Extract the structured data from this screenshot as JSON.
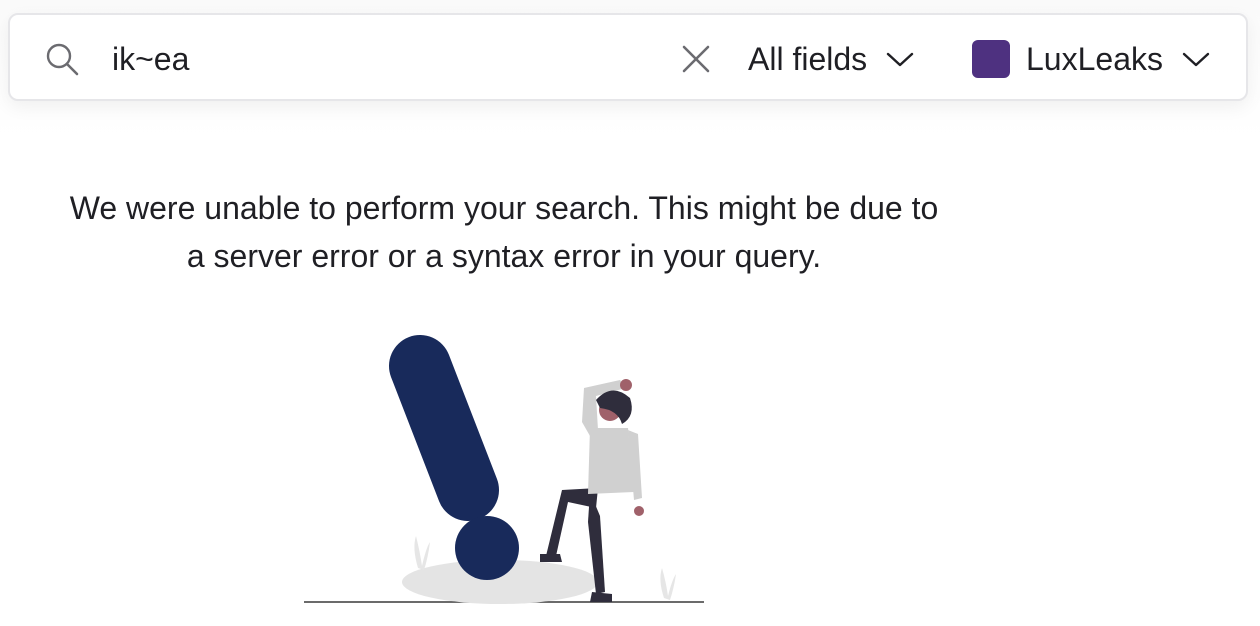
{
  "search": {
    "query": "ik~ea",
    "field_filter": "All fields",
    "project": {
      "name": "LuxLeaks",
      "color": "#4e3180"
    }
  },
  "error": {
    "message": "We were unable to perform your search. This might be due to a server error or a syntax error in your query."
  },
  "icons": {
    "search": "search-icon",
    "clear": "close-icon",
    "dropdown": "chevron-down-icon"
  },
  "colors": {
    "illustration_primary": "#182a5b",
    "illustration_person_shirt": "#d0d0d0",
    "illustration_person_pants": "#2f2d3c"
  }
}
